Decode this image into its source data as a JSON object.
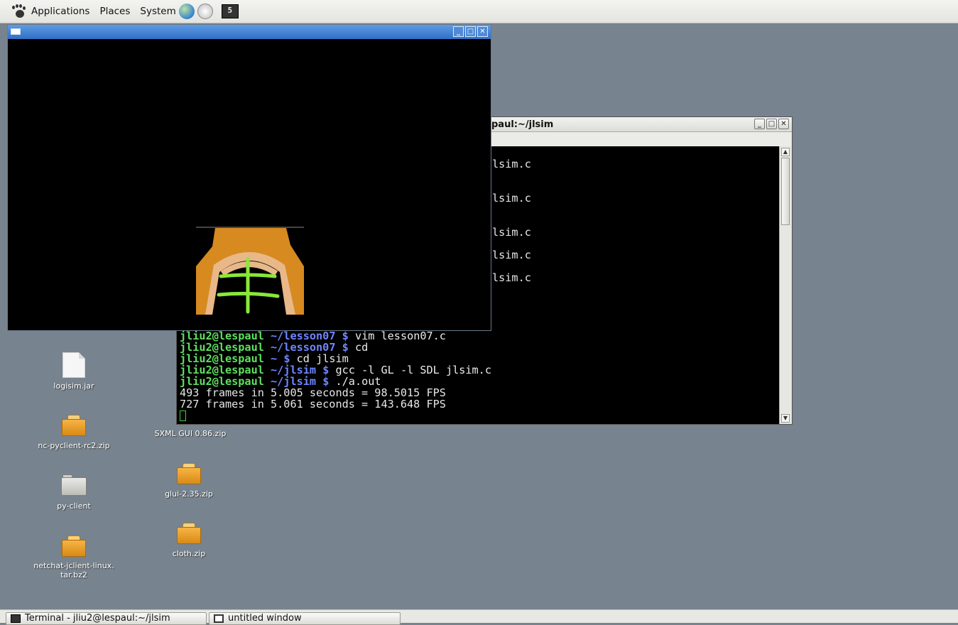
{
  "top_panel": {
    "menus": [
      "Applications",
      "Places",
      "System"
    ],
    "launchers": [
      "web-browser-icon",
      "email-client-icon",
      "terminal-launcher-icon"
    ]
  },
  "gl_window": {
    "title": ""
  },
  "terminal_window": {
    "title_visible": "paul:~/jlsim",
    "partial_lines": [
      "lsim.c",
      "lsim.c",
      "lsim.c",
      "lsim.c",
      "lsim.c"
    ],
    "lines": [
      {
        "user": "jliu2@lespaul",
        "path": "~/lesson07",
        "prompt": "$",
        "cmd": "vim lesson07.c"
      },
      {
        "user": "jliu2@lespaul",
        "path": "~/lesson07",
        "prompt": "$",
        "cmd": "cd"
      },
      {
        "user": "jliu2@lespaul",
        "path": "~",
        "prompt": "$",
        "cmd": "cd jlsim"
      },
      {
        "user": "jliu2@lespaul",
        "path": "~/jlsim",
        "prompt": "$",
        "cmd": "gcc -l GL -l SDL jlsim.c"
      },
      {
        "user": "jliu2@lespaul",
        "path": "~/jlsim",
        "prompt": "$",
        "cmd": "./a.out"
      }
    ],
    "output": [
      "493 frames in 5.005 seconds = 98.5015 FPS",
      "727 frames in 5.061 seconds = 143.648 FPS"
    ]
  },
  "desktop_icons": [
    {
      "label": "logisim.jar",
      "type": "document"
    },
    {
      "label": "nc-pyclient-rc2.zip",
      "type": "archive"
    },
    {
      "label": "SXML GUI 0.86.zip",
      "type": "archive"
    },
    {
      "label": "glui-2.35.zip",
      "type": "archive"
    },
    {
      "label": "py-client",
      "type": "folder"
    },
    {
      "label": "cloth.zip",
      "type": "archive"
    },
    {
      "label": "netchat-jclient-linux.\ntar.bz2",
      "type": "archive"
    }
  ],
  "taskbar": {
    "items": [
      {
        "label": "Terminal - jliu2@lespaul:~/jlsim"
      },
      {
        "label": "untitled window"
      }
    ]
  },
  "colors": {
    "desktop": "#77838e",
    "gl_titlebar": "#2f6fc6",
    "prompt_user": "#5fe05f",
    "prompt_path": "#6f86ff"
  }
}
